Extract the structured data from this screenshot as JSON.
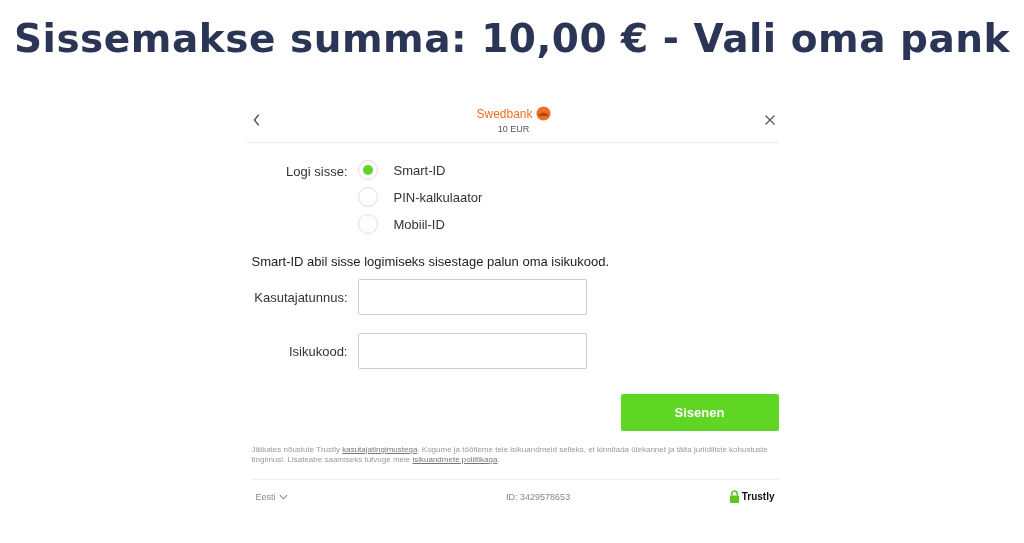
{
  "heading": "Sissemakse summa: 10,00 € - Vali oma pank",
  "header": {
    "bank": "Swedbank",
    "amount": "10 EUR"
  },
  "login": {
    "label": "Logi sisse:",
    "options": [
      {
        "label": "Smart-ID",
        "selected": true
      },
      {
        "label": "PIN-kalkulaator",
        "selected": false
      },
      {
        "label": "Mobiil-ID",
        "selected": false
      }
    ]
  },
  "instruction": "Smart-ID abil sisse logimiseks sisestage palun oma isikukood.",
  "fields": [
    {
      "label": "Kasutajatunnus:"
    },
    {
      "label": "Isikukood:"
    }
  ],
  "submit": "Sisenen",
  "legal": [
    {
      "kind": "text",
      "text": "Jätkates nõustute Trustly "
    },
    {
      "kind": "link",
      "text": "kasutajatingimustega"
    },
    {
      "kind": "text",
      "text": ". Kogume ja töötleme teie isikuandmeid selleks, et kinnitada ülekannet ja täita juriidiliste kohustuste tingimusi. Lisateabe saamiseks tutvuge meie "
    },
    {
      "kind": "link",
      "text": "isikuandmete poliitikaga"
    },
    {
      "kind": "text",
      "text": "."
    }
  ],
  "footer": {
    "language": "Eesti",
    "id": "ID: 3429578653",
    "brand": "Trustly"
  }
}
